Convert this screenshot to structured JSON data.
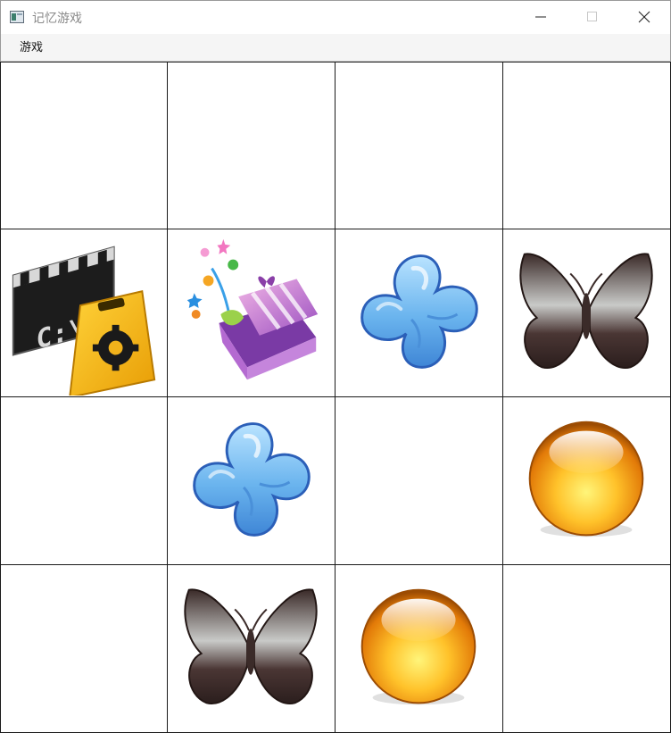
{
  "window": {
    "title": "记忆游戏"
  },
  "menu": {
    "items": [
      {
        "label": "游戏"
      }
    ]
  },
  "board": {
    "rows": 4,
    "cols": 4,
    "cells": [
      {
        "row": 0,
        "col": 0,
        "state": "hidden"
      },
      {
        "row": 0,
        "col": 1,
        "state": "hidden"
      },
      {
        "row": 0,
        "col": 2,
        "state": "hidden"
      },
      {
        "row": 0,
        "col": 3,
        "state": "hidden"
      },
      {
        "row": 1,
        "col": 0,
        "state": "revealed",
        "icon": "cmd-tool-sign-icon",
        "text": "C:\\"
      },
      {
        "row": 1,
        "col": 1,
        "state": "revealed",
        "icon": "gift-box-icon"
      },
      {
        "row": 1,
        "col": 2,
        "state": "revealed",
        "icon": "blue-flower-icon"
      },
      {
        "row": 1,
        "col": 3,
        "state": "revealed",
        "icon": "butterfly-icon"
      },
      {
        "row": 2,
        "col": 0,
        "state": "hidden"
      },
      {
        "row": 2,
        "col": 1,
        "state": "revealed",
        "icon": "blue-flower-icon"
      },
      {
        "row": 2,
        "col": 2,
        "state": "hidden"
      },
      {
        "row": 2,
        "col": 3,
        "state": "revealed",
        "icon": "orange-orb-icon"
      },
      {
        "row": 3,
        "col": 0,
        "state": "hidden"
      },
      {
        "row": 3,
        "col": 1,
        "state": "revealed",
        "icon": "butterfly-icon"
      },
      {
        "row": 3,
        "col": 2,
        "state": "revealed",
        "icon": "orange-orb-icon"
      },
      {
        "row": 3,
        "col": 3,
        "state": "hidden"
      }
    ]
  }
}
